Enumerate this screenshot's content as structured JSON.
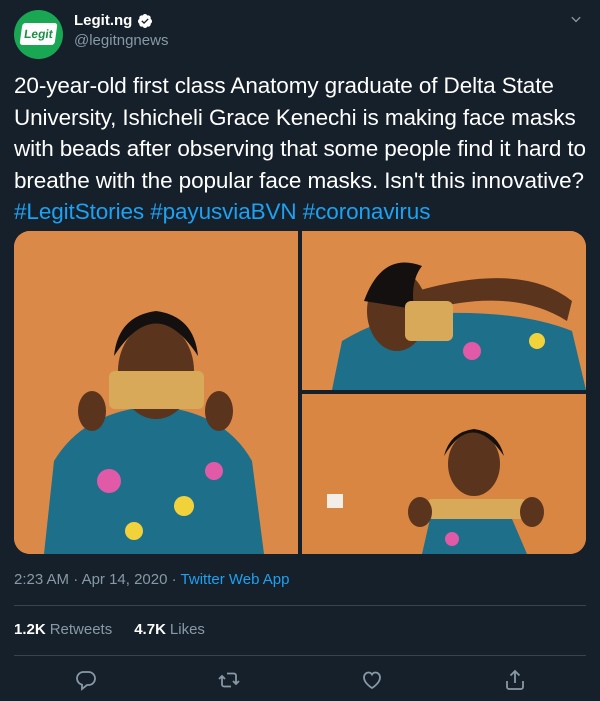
{
  "tweet": {
    "author": {
      "name": "Legit.ng",
      "handle": "@legitngnews",
      "avatar_text": "Legit"
    },
    "text_main": "20-year-old first class Anatomy graduate of Delta State University, Ishicheli Grace Kenechi is making face masks with beads after observing that some people find it hard to breathe with the popular face masks. Isn't this innovative?",
    "hashtags": [
      "#LegitStories",
      "#payusviaBVN",
      "#coronavirus"
    ],
    "time": "2:23 AM",
    "separator": "·",
    "date": "Apr 14, 2020",
    "source": "Twitter Web App",
    "retweets_count": "1.2K",
    "retweets_label": "Retweets",
    "likes_count": "4.7K",
    "likes_label": "Likes"
  },
  "icons": {
    "verified": "verified-badge-icon",
    "more": "chevron-down-icon",
    "reply": "reply-icon",
    "retweet": "retweet-icon",
    "like": "like-icon",
    "share": "share-icon"
  },
  "colors": {
    "background": "#15202b",
    "accent": "#1da1f2",
    "secondary_text": "#8899a6",
    "divider": "#38444d",
    "brand": "#1aa753"
  }
}
